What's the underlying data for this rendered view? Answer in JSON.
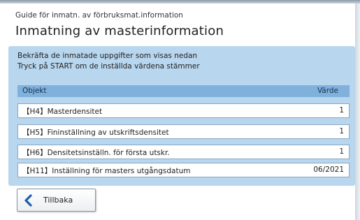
{
  "header": {
    "subtitle": "Guide för inmatn. av förbruksmat.information",
    "title": "Inmatning av masterinformation"
  },
  "message": {
    "line1": "Bekräfta de inmatade uppgifter som visas nedan",
    "line2": "Tryck på START om de inställda värdena stämmer"
  },
  "table": {
    "col_object": "Objekt",
    "col_value": "Värde",
    "rows": [
      {
        "label": "【H4】Masterdensitet",
        "value": "1"
      },
      {
        "label": "【H5】Fininställning av utskriftsdensitet",
        "value": "1"
      },
      {
        "label": "【H6】Densitetsinställn. för första utskr.",
        "value": "1"
      },
      {
        "label": "【H11】Inställning för masters utgångsdatum",
        "value": "06/2021"
      }
    ]
  },
  "footer": {
    "back_label": "Tillbaka",
    "back_icon": "chevron-left-icon"
  },
  "colors": {
    "panel": "#b8d6ee",
    "table_header": "#7fb1dc",
    "accent": "#1f5fa8"
  }
}
